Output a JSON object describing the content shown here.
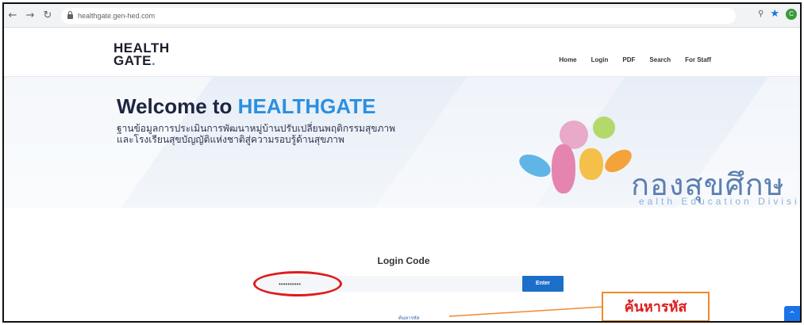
{
  "browser": {
    "url": "healthgate.gen-hed.com",
    "back_icon": "arrow-left",
    "forward_icon": "arrow-right",
    "reload_icon": "reload",
    "profile_initial": "C"
  },
  "site": {
    "logo_line1": "HEALTH",
    "logo_line2": "GATE",
    "logo_dot": ".",
    "nav": [
      "Home",
      "Login",
      "PDF",
      "Search",
      "For Staff"
    ]
  },
  "hero": {
    "title_prefix": "Welcome to ",
    "title_accent": "HEALTHGATE",
    "subtitle_line1": "ฐานข้อมูลการประเมินการพัฒนาหมู่บ้านปรับเปลี่ยนพฤติกรรมสุขภาพ",
    "subtitle_line2": "และโรงเรียนสุขบัญญัติแห่งชาติสู่ความรอบรู้ด้านสุขภาพ",
    "org_text": "กองสุขศึกษ",
    "org_subtext": "ealth Education Divisi"
  },
  "login": {
    "title": "Login Code",
    "input_value": "••••••••••",
    "enter_label": "Enter",
    "forgot_label": "ค้นหารหัส"
  },
  "annotation": {
    "label": "ค้นหารหัส"
  },
  "colors": {
    "accent": "#2b8fe0",
    "button": "#1c6fc9",
    "annotation_red": "#e01b1b",
    "callout_orange": "#f08a2a"
  }
}
